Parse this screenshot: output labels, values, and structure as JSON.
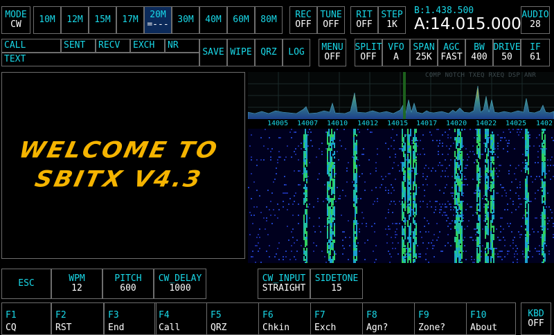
{
  "mode": {
    "label": "MODE",
    "value": "CW"
  },
  "bands": [
    "10M",
    "12M",
    "15M",
    "17M",
    "20M",
    "30M",
    "40M",
    "60M",
    "80M"
  ],
  "band_selected_marker": "=---",
  "rec": {
    "label": "REC",
    "value": "OFF"
  },
  "tune": {
    "label": "TUNE",
    "value": "OFF"
  },
  "rit": {
    "label": "RIT",
    "value": "OFF"
  },
  "step": {
    "label": "STEP",
    "value": "1K"
  },
  "freq_b": "B:1.438.500",
  "freq_a": "A:14.015.000",
  "audio": {
    "label": "AUDIO",
    "value": "28"
  },
  "log_fields": {
    "call": "CALL",
    "sent": "SENT",
    "recv": "RECV",
    "exch": "EXCH",
    "nr": "NR",
    "text": "TEXT"
  },
  "actions": {
    "save": "SAVE",
    "wipe": "WIPE",
    "qrz": "QRZ",
    "log": "LOG"
  },
  "menu": {
    "label": "MENU",
    "value": "OFF"
  },
  "split": {
    "label": "SPLIT",
    "value": "OFF"
  },
  "vfo": {
    "label": "VFO",
    "value": "A"
  },
  "span": {
    "label": "SPAN",
    "value": "25K"
  },
  "agc": {
    "label": "AGC",
    "value": "FAST"
  },
  "bw": {
    "label": "BW",
    "value": "400"
  },
  "drive": {
    "label": "DRIVE",
    "value": "50"
  },
  "if": {
    "label": "IF",
    "value": "61"
  },
  "dsp_flags": "COMP NOTCH TXEQ RXEQ DSP ANR",
  "welcome": {
    "line1": "WELCOME TO",
    "line2": "SBITX V4.3"
  },
  "freq_ticks": [
    "14005",
    "14007",
    "14010",
    "14012",
    "14015",
    "14017",
    "14020",
    "14022",
    "14025",
    "1402"
  ],
  "cw": {
    "esc": "ESC",
    "wpm": {
      "label": "WPM",
      "value": "12"
    },
    "pitch": {
      "label": "PITCH",
      "value": "600"
    },
    "cw_delay": {
      "label": "CW_DELAY",
      "value": "1000"
    },
    "cw_input": {
      "label": "CW_INPUT",
      "value": "STRAIGHT"
    },
    "sidetone": {
      "label": "SIDETONE",
      "value": "15"
    }
  },
  "fkeys": [
    {
      "key": "F1",
      "label": "CQ"
    },
    {
      "key": "F2",
      "label": "RST"
    },
    {
      "key": "F3",
      "label": "End"
    },
    {
      "key": "F4",
      "label": "Call"
    },
    {
      "key": "F5",
      "label": "QRZ"
    },
    {
      "key": "F6",
      "label": "Chkin"
    },
    {
      "key": "F7",
      "label": "Exch"
    },
    {
      "key": "F8",
      "label": "Agn?"
    },
    {
      "key": "F9",
      "label": "Zone?"
    },
    {
      "key": "F10",
      "label": "About"
    }
  ],
  "kbd": {
    "label": "KBD",
    "value": "OFF"
  },
  "colors": {
    "accent": "#19d8e8",
    "value": "#ffffff",
    "border": "#6e6e6e",
    "welcome": "#f5b400",
    "selected": "#0b2a5a"
  }
}
